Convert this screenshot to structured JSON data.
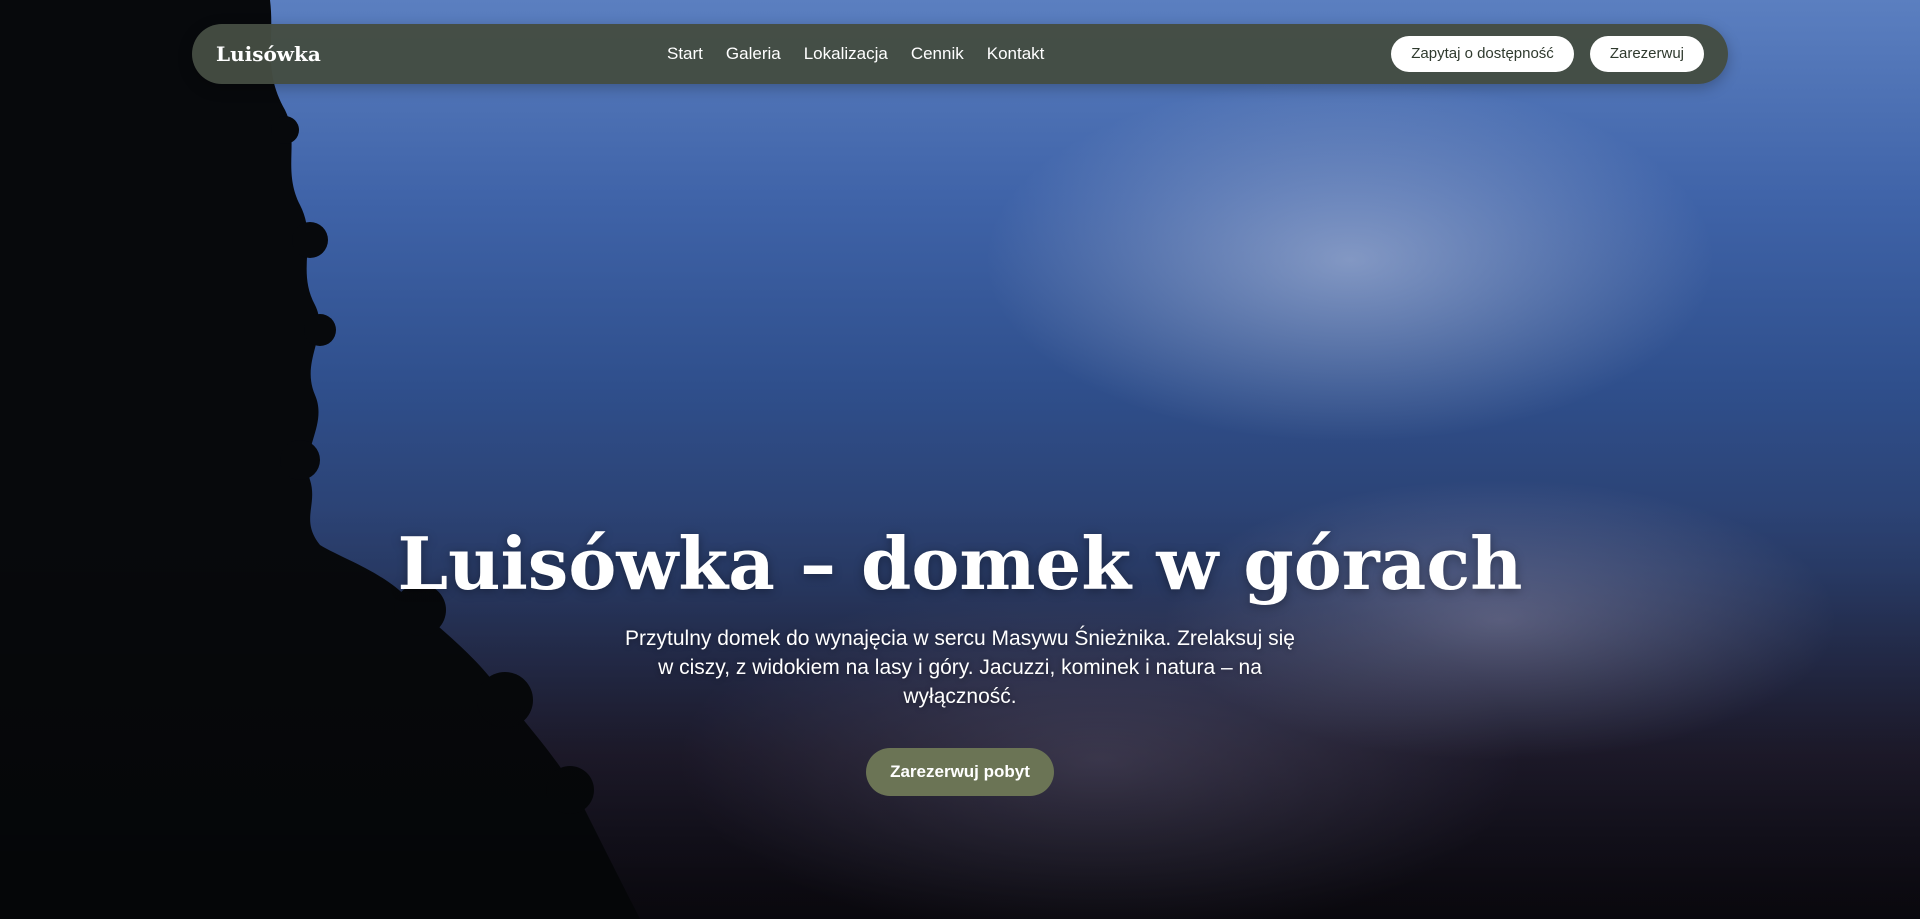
{
  "nav": {
    "brand": "Luisówka",
    "links": [
      {
        "label": "Start"
      },
      {
        "label": "Galeria"
      },
      {
        "label": "Lokalizacja"
      },
      {
        "label": "Cennik"
      },
      {
        "label": "Kontakt"
      }
    ],
    "actions": {
      "inquiry_label": "Zapytaj o dostępność",
      "reserve_label": "Zarezerwuj"
    }
  },
  "hero": {
    "title": "Luisówka – domek w górach",
    "subtitle": "Przytulny domek do wynajęcia w sercu Masywu Śnieżnika. Zrelaksuj się w ciszy, z widokiem na lasy i góry. Jacuzzi, kominek i natura – na wyłączność.",
    "cta_label": "Zarezerwuj pobyt",
    "background": "sky-with-clouds-and-tree-silhouette"
  },
  "colors": {
    "navbar_bg": "#444c42",
    "button_bg": "#ffffff",
    "cta_bg": "#6b7455",
    "text": "#ffffff"
  }
}
